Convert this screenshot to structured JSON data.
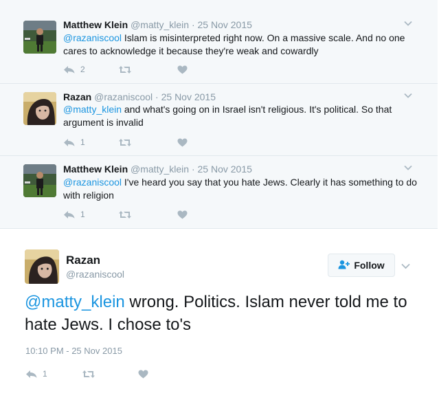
{
  "replies": [
    {
      "name": "Matthew Klein",
      "handle": "@matty_klein",
      "sep": "·",
      "date": "25 Nov 2015",
      "mention": "@razaniscool",
      "text": " Islam is misinterpreted right now. On a massive scale. And no one cares to acknowledge it because they're weak and cowardly",
      "reply_count": "2",
      "retweet_count": "",
      "like_count": "",
      "avatar": "avatar-matthew"
    },
    {
      "name": "Razan",
      "handle": "@razaniscool",
      "sep": "·",
      "date": "25 Nov 2015",
      "mention": "@matty_klein",
      "text": " and what's going on in Israel isn't religious. It's political. So that argument is invalid",
      "reply_count": "1",
      "retweet_count": "",
      "like_count": "",
      "avatar": "avatar-razan"
    },
    {
      "name": "Matthew Klein",
      "handle": "@matty_klein",
      "sep": "·",
      "date": "25 Nov 2015",
      "mention": "@razaniscool",
      "text": " I've heard you say that you hate Jews. Clearly it has something to do with religion",
      "reply_count": "1",
      "retweet_count": "",
      "like_count": "",
      "avatar": "avatar-matthew"
    }
  ],
  "main_tweet": {
    "name": "Razan",
    "handle": "@razaniscool",
    "follow_label": "Follow",
    "mention": "@matty_klein",
    "text": " wrong. Politics. Islam never told me to hate Jews. I chose to's",
    "timestamp": "10:10 PM - 25 Nov 2015",
    "reply_count": "1",
    "retweet_count": "",
    "like_count": ""
  },
  "colors": {
    "link": "#1b95e0",
    "muted": "#8899a6",
    "icon": "#aab8c2",
    "reply_bg": "#f5f8fa"
  },
  "icons": [
    "reply-icon",
    "retweet-icon",
    "like-icon",
    "chevron-down-icon",
    "follow-person-icon"
  ]
}
